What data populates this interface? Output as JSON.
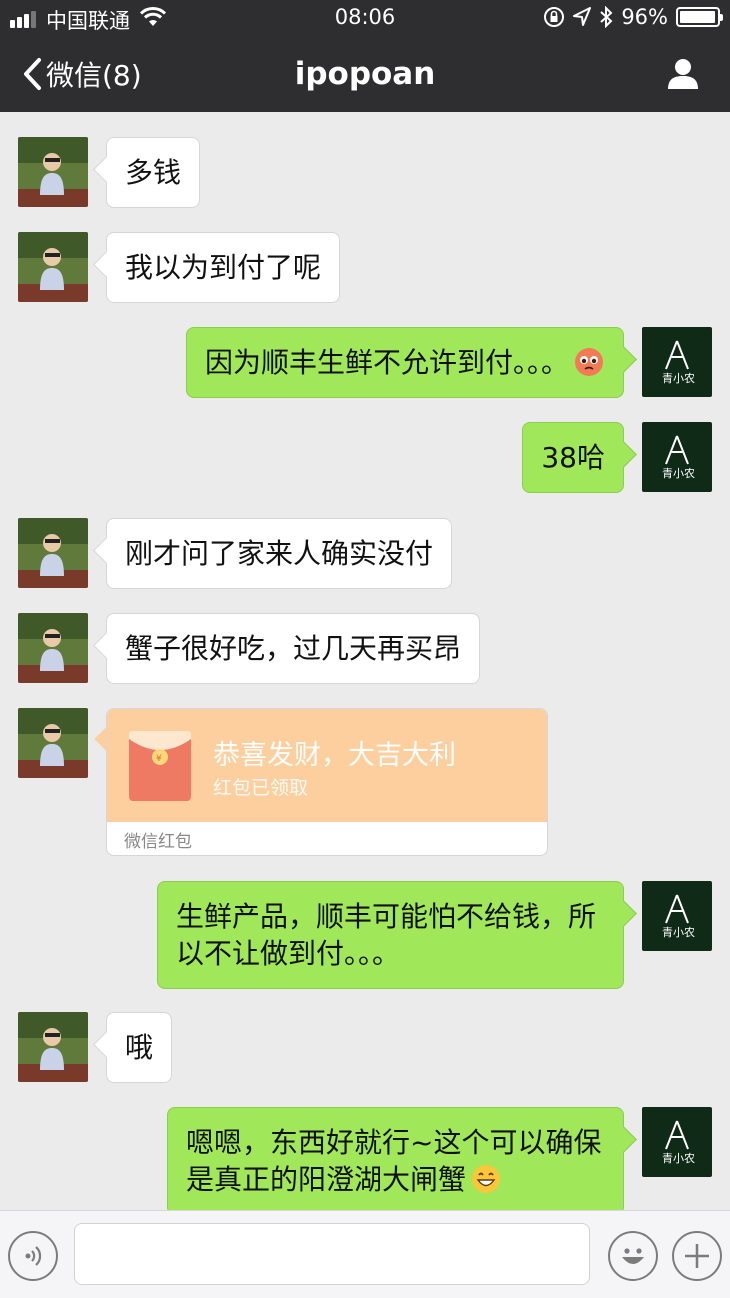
{
  "status_bar": {
    "carrier": "中国联通",
    "time": "08:06",
    "battery": "96%",
    "battery_level": 0.96,
    "signal_bars": 3
  },
  "nav": {
    "back_label": "微信(8)",
    "title": "ipopoan"
  },
  "messages": [
    {
      "side": "in",
      "text": "多钱"
    },
    {
      "side": "in",
      "text": "我以为到付了呢"
    },
    {
      "side": "out",
      "text": "因为顺丰生鲜不允许到付。。。",
      "emoji": "pleading-face"
    },
    {
      "side": "out",
      "text": "38哈"
    },
    {
      "side": "in",
      "text": "刚才问了家来人确实没付"
    },
    {
      "side": "in",
      "text": "蟹子很好吃，过几天再买昂"
    },
    {
      "side": "in",
      "type": "red_packet",
      "title": "恭喜发财，大吉大利",
      "status": "红包已领取",
      "footer": "微信红包"
    },
    {
      "side": "out",
      "lines": [
        "生鲜产品，顺丰可能怕不给钱，所",
        "以不让做到付。。。"
      ]
    },
    {
      "side": "in",
      "text": "哦"
    },
    {
      "side": "out",
      "lines": [
        "嗯嗯，东西好就行~这个可以确保",
        "是真正的阳澄湖大闸蟹"
      ],
      "emoji": "grinning-face"
    }
  ],
  "colors": {
    "header_bg": "#2e2e30",
    "chat_bg": "#ebebeb",
    "outgoing_bubble": "#a0e75a",
    "incoming_bubble": "#ffffff",
    "red_packet": "#fdcf9e"
  },
  "icons": [
    "back-chevron-icon",
    "wifi-icon",
    "lock-rotation-icon",
    "location-arrow-icon",
    "bluetooth-icon",
    "profile-icon",
    "voice-icon",
    "emoji-icon",
    "plus-icon"
  ]
}
